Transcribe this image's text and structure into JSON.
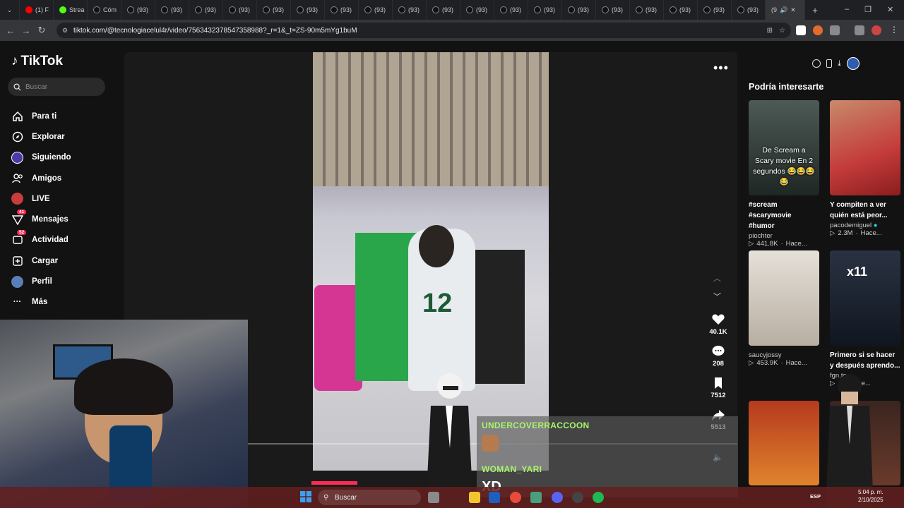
{
  "browser": {
    "tabs": [
      {
        "label": "(1) F"
      },
      {
        "label": "Strea"
      },
      {
        "label": "Cóm"
      },
      {
        "label": "(93)"
      },
      {
        "label": "(93)"
      },
      {
        "label": "(93)"
      },
      {
        "label": "(93)"
      },
      {
        "label": "(93)"
      },
      {
        "label": "(93)"
      },
      {
        "label": "(93)"
      },
      {
        "label": "(93)"
      },
      {
        "label": "(93)"
      },
      {
        "label": "(93)"
      },
      {
        "label": "(93)"
      },
      {
        "label": "(93)"
      },
      {
        "label": "(93)"
      },
      {
        "label": "(93)"
      },
      {
        "label": "(93)"
      },
      {
        "label": "(93)"
      },
      {
        "label": "(93)"
      },
      {
        "label": "(93)"
      },
      {
        "label": "(93)"
      },
      {
        "label": "(9"
      }
    ],
    "url": "tiktok.com/@tecnologiacelul4r/video/7563432378547358988?_r=1&_t=ZS-90m5mYg1buM"
  },
  "sidebar": {
    "logo": "TikTok",
    "search_placeholder": "Buscar",
    "items": [
      {
        "label": "Para ti",
        "icon": "home-icon"
      },
      {
        "label": "Explorar",
        "icon": "compass-icon"
      },
      {
        "label": "Siguiendo",
        "icon": "following-avatar-icon"
      },
      {
        "label": "Amigos",
        "icon": "friends-icon"
      },
      {
        "label": "LIVE",
        "icon": "live-icon"
      },
      {
        "label": "Mensajes",
        "icon": "send-icon",
        "badge": "41"
      },
      {
        "label": "Actividad",
        "icon": "inbox-icon",
        "badge": "52"
      },
      {
        "label": "Cargar",
        "icon": "upload-icon"
      },
      {
        "label": "Perfil",
        "icon": "profile-avatar-icon"
      },
      {
        "label": "Más",
        "icon": "more-icon"
      }
    ]
  },
  "video": {
    "jersey_number": "12",
    "likes": "40.1K",
    "comments": "208",
    "saves": "7512",
    "shares": "5513"
  },
  "recommendations": {
    "title": "Podría interesarte",
    "cards": [
      {
        "overlay": "De Scream a Scary movie En 2 segundos 😂😂😂😂",
        "title": "#scream #scarymovie #humor",
        "author": "piochter",
        "views": "441.8K",
        "time": "Hace..."
      },
      {
        "overlay": "",
        "title": "Y compiten a ver quién está peor...",
        "author": "pacodemiguel",
        "views": "2.3M",
        "time": "Hace..."
      },
      {
        "overlay": "",
        "title": "",
        "author": "saucyjossy",
        "views": "453.9K",
        "time": "Hace..."
      },
      {
        "overlay": "",
        "title": "Primero si se hacer y después aprendo...",
        "author": "fgn.te",
        "views": "4",
        "time": "Hace..."
      }
    ]
  },
  "stream_overlay": {
    "chat": [
      {
        "user": "UNDERCOVERRACCOON",
        "message": ""
      },
      {
        "user": "WOMAN_YARI",
        "message": "XD"
      }
    ],
    "overlay_badge": "x11"
  },
  "taskbar": {
    "search_placeholder": "Buscar",
    "language": "ESP",
    "time": "5:04 p. m.",
    "date": "2/10/2025"
  },
  "colors": {
    "accent": "#fe2c55",
    "chat_name": "#a7f56b",
    "background": "#121212"
  }
}
